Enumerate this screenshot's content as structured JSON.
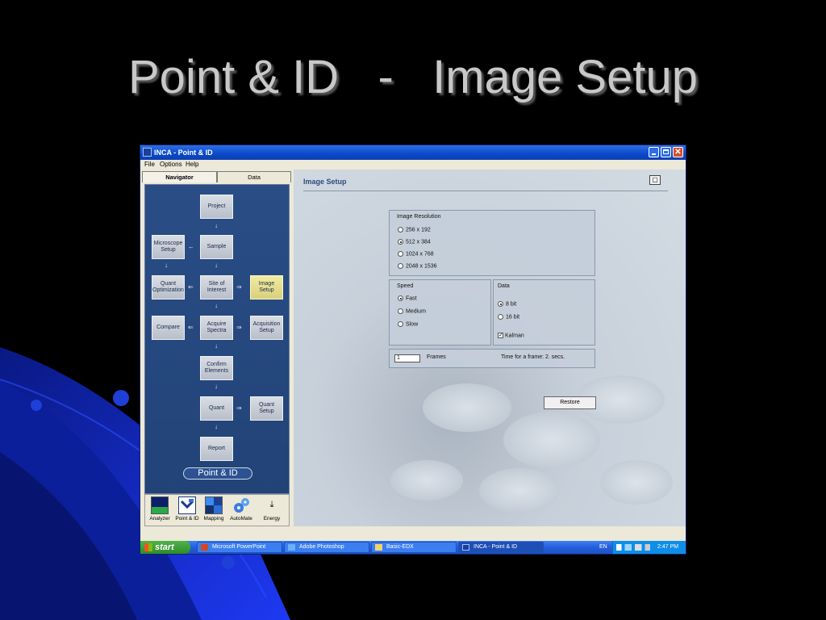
{
  "slide": {
    "title": "Point & ID   -   Image Setup"
  },
  "window": {
    "title": "INCA - Point & ID",
    "menu": [
      "File",
      "Options",
      "Help"
    ]
  },
  "navigator": {
    "tabs": [
      "Navigator",
      "Data"
    ],
    "nodes": {
      "project": "Project",
      "sample": "Sample",
      "microscope_setup": "Microscope Setup",
      "quant_optimization": "Quant Optimization",
      "site_of_interest": "Site of Interest",
      "image_setup": "Image Setup",
      "compare": "Compare",
      "acquire_spectra": "Acquire Spectra",
      "acquisition_setup": "Acquisition Setup",
      "confirm_elements": "Confirm Elements",
      "quant": "Quant",
      "quant_setup": "Quant Setup",
      "report": "Report"
    },
    "badge": "Point & ID",
    "modules": [
      "Analyzer",
      "Point & ID",
      "Mapping",
      "AutoMate",
      "Energy"
    ]
  },
  "image_setup": {
    "title": "Image Setup",
    "resolution": {
      "label": "Image Resolution",
      "options": [
        "256 x 192",
        "512 x 384",
        "1024 x 768",
        "2048 x 1536"
      ],
      "selected": "512 x 384"
    },
    "speed": {
      "label": "Speed",
      "options": [
        "Fast",
        "Medium",
        "Slow"
      ],
      "selected": "Fast"
    },
    "data": {
      "label": "Data",
      "options": [
        "8 bit",
        "16 bit"
      ],
      "selected": "8 bit",
      "kalman_label": "Kalman",
      "kalman_checked": true
    },
    "frames": {
      "value": "1",
      "label": "Frames",
      "time_text": "Time for a frame: 2. secs."
    },
    "restore_label": "Restore"
  },
  "taskbar": {
    "start_label": "start",
    "tasks": [
      "Microsoft PowerPoint",
      "Adobe Photoshop",
      "Basic-EDX",
      "INCA - Point & ID"
    ],
    "active_task": "INCA - Point & ID",
    "language": "EN",
    "clock": "2:47 PM"
  }
}
